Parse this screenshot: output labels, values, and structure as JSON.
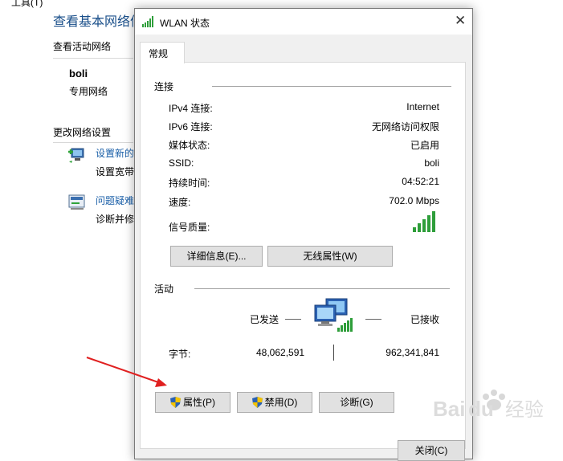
{
  "background": {
    "top_cut_text": "工具(T)",
    "title": "查看基本网络信",
    "active_networks_label": "查看活动网络",
    "network_name": "boli",
    "network_type": "专用网络",
    "change_settings_label": "更改网络设置",
    "link1_title": "设置新的",
    "link1_desc": "设置宽带",
    "link2_title": "问题疑难",
    "link2_desc": "诊断并修"
  },
  "dialog": {
    "title": "WLAN 状态",
    "tab_general": "常规",
    "connection_group": "连接",
    "rows": [
      {
        "label": "IPv4 连接:",
        "value": "Internet"
      },
      {
        "label": "IPv6 连接:",
        "value": "无网络访问权限"
      },
      {
        "label": "媒体状态:",
        "value": "已启用"
      },
      {
        "label": "SSID:",
        "value": "boli"
      },
      {
        "label": "持续时间:",
        "value": "04:52:21"
      },
      {
        "label": "速度:",
        "value": "702.0 Mbps"
      }
    ],
    "signal_label": "信号质量:",
    "signal_bars": 5,
    "details_button": "详细信息(E)...",
    "wireless_props_button": "无线属性(W)",
    "activity_group": "活动",
    "sent_label": "已发送",
    "received_label": "已接收",
    "bytes_label": "字节:",
    "bytes_sent": "48,062,591",
    "bytes_received": "962,341,841",
    "properties_button": "属性(P)",
    "disable_button": "禁用(D)",
    "diagnose_button": "诊断(G)",
    "close_button_partial": "关闭(C)"
  },
  "watermark": {
    "text": "Baidu 经验"
  },
  "colors": {
    "link": "#1a5fa8",
    "title": "#1a4f8a",
    "signal": "#2e9e3a",
    "arrow": "#e02020"
  }
}
